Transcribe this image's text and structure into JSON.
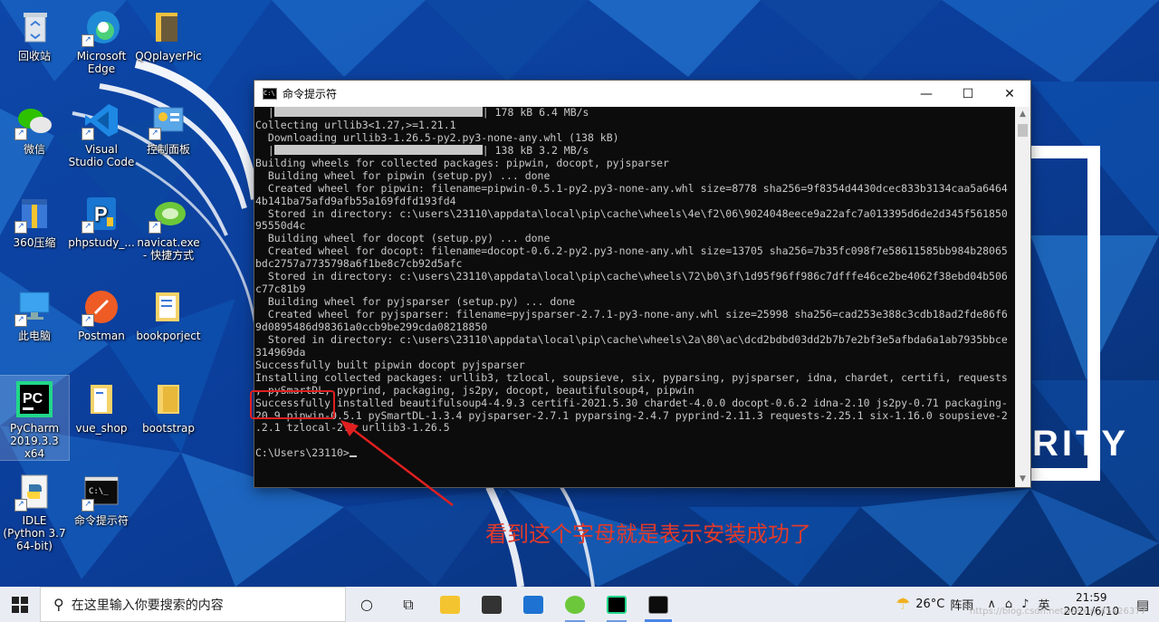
{
  "desktop": {
    "icons": [
      {
        "label": "回收站"
      },
      {
        "label": "Microsoft Edge"
      },
      {
        "label": "QQplayerPic"
      },
      {
        "label": "微信"
      },
      {
        "label": "Visual Studio Code"
      },
      {
        "label": "控制面板"
      },
      {
        "label": "360压缩"
      },
      {
        "label": "phpstudy_..."
      },
      {
        "label": "navicat.exe - 快捷方式"
      },
      {
        "label": "此电脑"
      },
      {
        "label": "Postman"
      },
      {
        "label": "bookporject"
      },
      {
        "label": "PyCharm 2019.3.3 x64"
      },
      {
        "label": "vue_shop"
      },
      {
        "label": "bootstrap"
      },
      {
        "label": "IDLE (Python 3.7 64-bit)"
      },
      {
        "label": "命令提示符"
      }
    ],
    "wallpaper_text": "RITY"
  },
  "cmd_window": {
    "title": "命令提示符",
    "icon_text": "C:\\",
    "controls": {
      "minimize": "—",
      "maximize": "☐",
      "close": "✕"
    },
    "lines": [
      "  |                                 | 178 kB 6.4 MB/s",
      "Collecting urllib3<1.27,>=1.21.1",
      "  Downloading urllib3-1.26.5-py2.py3-none-any.whl (138 kB)",
      "  |                                 | 138 kB 3.2 MB/s",
      "Building wheels for collected packages: pipwin, docopt, pyjsparser",
      "  Building wheel for pipwin (setup.py) ... done",
      "  Created wheel for pipwin: filename=pipwin-0.5.1-py2.py3-none-any.whl size=8778 sha256=9f8354d4430dcec833b3134caa5a6464",
      "4b141ba75afd9afb55a169fdfd193fd4",
      "  Stored in directory: c:\\users\\23110\\appdata\\local\\pip\\cache\\wheels\\4e\\f2\\06\\9024048eece9a22afc7a013395d6de2d345f561850",
      "95550d4c",
      "  Building wheel for docopt (setup.py) ... done",
      "  Created wheel for docopt: filename=docopt-0.6.2-py2.py3-none-any.whl size=13705 sha256=7b35fc098f7e58611585bb984b28065",
      "bdc2757a7735798a6f1be8c7cb92d5afc",
      "  Stored in directory: c:\\users\\23110\\appdata\\local\\pip\\cache\\wheels\\72\\b0\\3f\\1d95f96ff986c7dfffe46ce2be4062f38ebd04b506",
      "c77c81b9",
      "  Building wheel for pyjsparser (setup.py) ... done",
      "  Created wheel for pyjsparser: filename=pyjsparser-2.7.1-py3-none-any.whl size=25998 sha256=cad253e388c3cdb18ad2fde86f6",
      "9d0895486d98361a0ccb9be299cda08218850",
      "  Stored in directory: c:\\users\\23110\\appdata\\local\\pip\\cache\\wheels\\2a\\80\\ac\\dcd2bdbd03dd2b7b7e2bf3e5afbda6a1ab7935bbce",
      "314969da",
      "Successfully built pipwin docopt pyjsparser",
      "Installing collected packages: urllib3, tzlocal, soupsieve, six, pyparsing, pyjsparser, idna, chardet, certifi, requests",
      ", pySmartDL, pyprind, packaging, js2py, docopt, beautifulsoup4, pipwin",
      "Successfully installed beautifulsoup4-4.9.3 certifi-2021.5.30 chardet-4.0.0 docopt-0.6.2 idna-2.10 js2py-0.71 packaging-",
      "20.9 pipwin-0.5.1 pySmartDL-1.3.4 pyjsparser-2.7.1 pyparsing-2.4.7 pyprind-2.11.3 requests-2.25.1 six-1.16.0 soupsieve-2",
      ".2.1 tzlocal-2.1 urllib3-1.26.5",
      "",
      "C:\\Users\\23110>"
    ]
  },
  "annotation": {
    "text": "看到这个字母就是表示安装成功了",
    "color": "#e23a2a"
  },
  "taskbar": {
    "search_placeholder": "在这里输入你要搜索的内容",
    "weather_temp": "26°C",
    "weather_desc": "阵雨",
    "ime": "英",
    "time": "21:59",
    "date": "2021/6/10",
    "watermark": "https://blog.csdn.net/weixin_45426377"
  }
}
